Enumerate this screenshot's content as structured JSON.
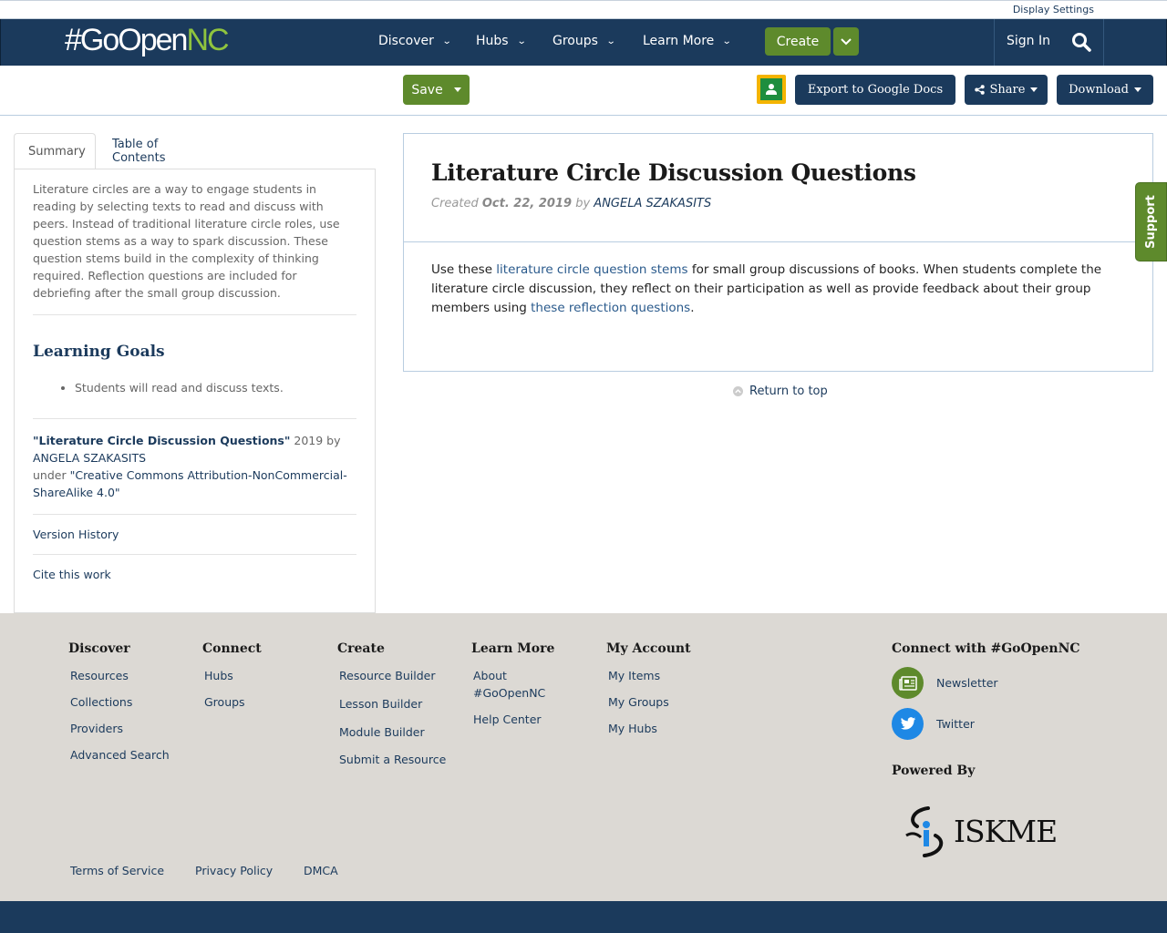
{
  "topbar": {
    "display_settings": "Display Settings"
  },
  "nav": {
    "logo_hash_go_open": "#GoOpen",
    "logo_nc": "NC",
    "items": [
      {
        "label": "Discover"
      },
      {
        "label": "Hubs"
      },
      {
        "label": "Groups"
      },
      {
        "label": "Learn More"
      }
    ],
    "create_label": "Create",
    "sign_in": "Sign In",
    "brand_color": "#1b3a5c",
    "accent_color": "#5e8a2c"
  },
  "toolbar": {
    "save_label": "Save",
    "export_label": "Export to Google Docs",
    "share_label": "Share",
    "download_label": "Download"
  },
  "left": {
    "tabs": [
      {
        "label": "Summary",
        "active": true
      },
      {
        "label": "Table of Contents",
        "active": false
      }
    ],
    "summary": "Literature circles are a way to engage students in reading by selecting texts to read and discuss with peers. Instead of traditional literature circle roles, use question stems as a way to spark discussion. These question stems build in the complexity of thinking required. Reflection questions are included for debriefing after the small group discussion.",
    "learning_goals_title": "Learning Goals",
    "learning_goals": [
      "Students will read and discuss texts."
    ],
    "attribution": {
      "title": "\"Literature Circle Discussion Questions\"",
      "year_by": " 2019 by",
      "author": "ANGELA SZAKASITS",
      "under": "under ",
      "license": "\"Creative Commons Attribution-NonCommercial-ShareAlike 4.0\""
    },
    "version_history": "Version History",
    "cite": "Cite this work"
  },
  "main": {
    "title": "Literature Circle Discussion Questions",
    "created_label": "Created",
    "created_date": "Oct. 22, 2019",
    "by_label": "by",
    "author": "ANGELA SZAKASITS",
    "body_part1": "Use these ",
    "body_link1": "literature circle question stems",
    "body_part2": " for small group discussions of books. When students complete the literature circle discussion, they reflect on their participation as well as provide feedback about their group members using ",
    "body_link2": "these reflection questions",
    "body_part3": ".",
    "return_top": "Return to top"
  },
  "support_label": "Support",
  "footer": {
    "columns": [
      {
        "title": "Discover",
        "links": [
          "Resources",
          "Collections",
          "Providers",
          "Advanced Search"
        ]
      },
      {
        "title": "Connect",
        "links": [
          "Hubs",
          "Groups"
        ]
      },
      {
        "title": "Create",
        "links": [
          "Resource Builder",
          "Lesson Builder",
          "Module Builder",
          "Submit a Resource"
        ]
      },
      {
        "title": "Learn More",
        "links": [
          "About #GoOpenNC",
          "Help Center"
        ]
      },
      {
        "title": "My Account",
        "links": [
          "My Items",
          "My Groups",
          "My Hubs"
        ]
      }
    ],
    "connect_title": "Connect with #GoOpenNC",
    "newsletter": "Newsletter",
    "twitter": "Twitter",
    "powered_by": "Powered By",
    "iskme_label": "ISKME",
    "legal": [
      "Terms of Service",
      "Privacy Policy",
      "DMCA"
    ]
  }
}
